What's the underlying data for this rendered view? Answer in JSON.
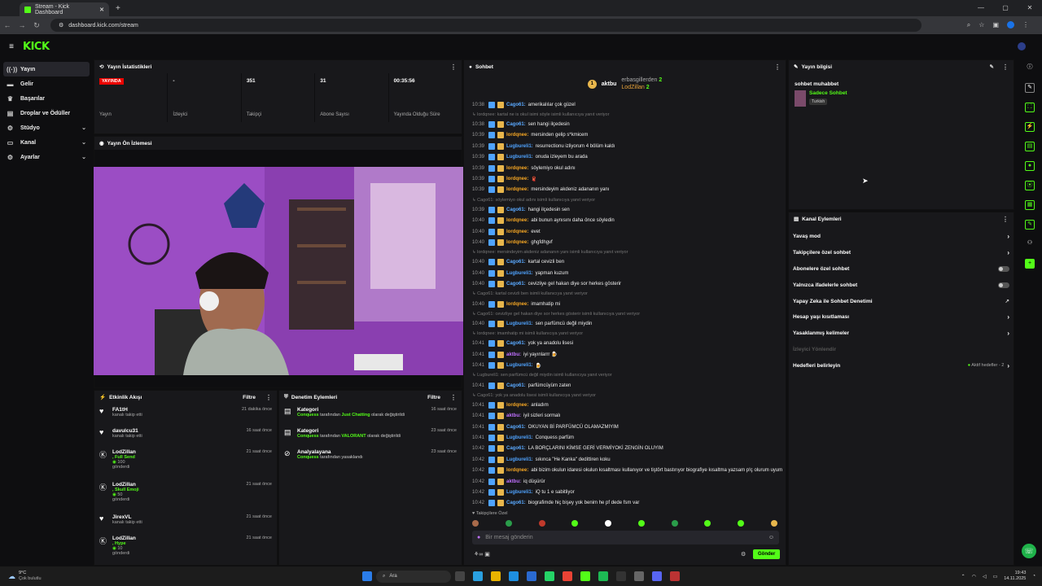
{
  "browser": {
    "tab_title": "Stream - Kick Dashboard",
    "url": "dashboard.kick.com/stream"
  },
  "brand": {
    "logo": "KICK",
    "accent": "#53fc18"
  },
  "sidebar": {
    "items": [
      {
        "label": "Yayın",
        "icon": "broadcast-icon",
        "active": true,
        "chevron": false
      },
      {
        "label": "Gelir",
        "icon": "money-icon",
        "active": false,
        "chevron": false
      },
      {
        "label": "Başarılar",
        "icon": "trophy-icon",
        "active": false,
        "chevron": false
      },
      {
        "label": "Droplar ve Ödüller",
        "icon": "gift-icon",
        "active": false,
        "chevron": false
      },
      {
        "label": "Stüdyo",
        "icon": "studio-icon",
        "active": false,
        "chevron": true
      },
      {
        "label": "Kanal",
        "icon": "channel-icon",
        "active": false,
        "chevron": true
      },
      {
        "label": "Ayarlar",
        "icon": "gear-icon",
        "active": false,
        "chevron": true
      }
    ]
  },
  "stats_panel": {
    "title": "Yayın İstatistikleri",
    "stats": [
      {
        "value": "YAYINDA",
        "label": "Yayın"
      },
      {
        "value": "-",
        "label": "İzleyici"
      },
      {
        "value": "351",
        "label": "Takipçi"
      },
      {
        "value": "31",
        "label": "Abone Sayısı"
      },
      {
        "value": "00:35:56",
        "label": "Yayında Olduğu Süre"
      }
    ]
  },
  "preview_panel": {
    "title": "Yayın Ön İzlemesi"
  },
  "activity_panel": {
    "title": "Etkinlik Akışı",
    "filter": "Filtre",
    "items": [
      {
        "icon": "heart-icon",
        "name": "FA1tH",
        "sub": "kanalı takip etti",
        "extra": "",
        "amount": "",
        "time": "21 dakika önce"
      },
      {
        "icon": "heart-icon",
        "name": "davulcu31",
        "sub": "kanalı takip etti",
        "extra": "",
        "amount": "",
        "time": "16 saat önce"
      },
      {
        "icon": "kick-icon",
        "name": "LodZillan",
        "sub": "gönderdi",
        "extra": ", Full Send",
        "amount": "100",
        "time": "21 saat önce"
      },
      {
        "icon": "kick-icon",
        "name": "LodZillan",
        "sub": "gönderdi",
        "extra": ", Skull Emoji",
        "amount": "50",
        "time": "21 saat önce"
      },
      {
        "icon": "heart-icon",
        "name": "JirexVL",
        "sub": "kanalı takip etti",
        "extra": "",
        "amount": "",
        "time": "21 saat önce"
      },
      {
        "icon": "kick-icon",
        "name": "LodZillan",
        "sub": "gönderdi",
        "extra": ", Hype",
        "amount": "10",
        "time": "21 saat önce"
      }
    ]
  },
  "moderation_panel": {
    "title": "Denetim Eylemleri",
    "filter": "Filtre",
    "items": [
      {
        "icon": "category-icon",
        "name": "Kategori",
        "who": "Conquess",
        "mid": " tarafından ",
        "target": "Just Chatting",
        "end": " olarak değiştirildi",
        "time": "16 saat önce"
      },
      {
        "icon": "category-icon",
        "name": "Kategori",
        "who": "Conquess",
        "mid": " tarafından ",
        "target": "VALORANT",
        "end": " olarak değiştirildi",
        "time": "23 saat önce"
      },
      {
        "icon": "ban-icon",
        "name": "Analyalayana",
        "who": "Conquess",
        "mid": " tarafından yasaklandı",
        "target": "",
        "end": "",
        "time": "23 saat önce"
      }
    ]
  },
  "chat_panel": {
    "title": "Sohbet",
    "leaderboard": [
      {
        "name": "aktbu",
        "count": "",
        "color": "#e8b64c"
      },
      {
        "name": "erbasgillerden",
        "count": "2",
        "color": "#aaaaaa"
      },
      {
        "name": "LodZillan",
        "count": "2",
        "color": "#e8a33a"
      }
    ],
    "lines": [
      {
        "type": "msg",
        "ts": "10:38",
        "user": "Cago61:",
        "ucolor": "#5aa9ff",
        "text": " amerikalılar çok güzel"
      },
      {
        "type": "reply",
        "text": "lordqnee: kartal ne is okul isimi söyle isimli kullanıcıya yanıt veriyor"
      },
      {
        "type": "msg",
        "ts": "10:38",
        "user": "Cago61:",
        "ucolor": "#5aa9ff",
        "text": " sen hangi ilçedesin"
      },
      {
        "type": "msg",
        "ts": "10:39",
        "user": "lordqnee:",
        "ucolor": "#f5a623",
        "text": " mersinden gelip s*kmicem"
      },
      {
        "type": "msg",
        "ts": "10:39",
        "user": "Lugbureli1:",
        "ucolor": "#4fa3ff",
        "text": " resurrectionu izliyorum 4 bölüm kaldı"
      },
      {
        "type": "msg",
        "ts": "10:39",
        "user": "Lugbureli1:",
        "ucolor": "#4fa3ff",
        "text": " onuda izleyem bu arada"
      },
      {
        "type": "msg",
        "ts": "10:39",
        "user": "lordqnee:",
        "ucolor": "#f5a623",
        "text": " söylemiyo okul adını"
      },
      {
        "type": "msg",
        "ts": "10:39",
        "user": "lordqnee:",
        "ucolor": "#f5a623",
        "text": " 🧣"
      },
      {
        "type": "msg",
        "ts": "10:39",
        "user": "lordqnee:",
        "ucolor": "#f5a623",
        "text": " mersindeyim akdeniz adananın yanı"
      },
      {
        "type": "reply",
        "text": "Cago61: söylemiyo okul adını isimli kullanıcıya yanıt veriyor"
      },
      {
        "type": "msg",
        "ts": "10:39",
        "user": "Cago61:",
        "ucolor": "#5aa9ff",
        "text": " hangi ilçedesin sen"
      },
      {
        "type": "msg",
        "ts": "10:40",
        "user": "lordqnee:",
        "ucolor": "#f5a623",
        "text": " abi bunun aynısını daha önce söyledin"
      },
      {
        "type": "msg",
        "ts": "10:40",
        "user": "lordqnee:",
        "ucolor": "#f5a623",
        "text": " evet"
      },
      {
        "type": "msg",
        "ts": "10:40",
        "user": "lordqnee:",
        "ucolor": "#f5a623",
        "text": " ghgfdhgvf"
      },
      {
        "type": "reply",
        "text": "lordqnee: mersindeyim akdeniz adananın yanı isimli kullanıcıya yanıt veriyor"
      },
      {
        "type": "msg",
        "ts": "10:40",
        "user": "Cago61:",
        "ucolor": "#5aa9ff",
        "text": " kartal cevizli ben"
      },
      {
        "type": "msg",
        "ts": "10:40",
        "user": "Lugbureli1:",
        "ucolor": "#4fa3ff",
        "text": " yapman kuzum"
      },
      {
        "type": "msg",
        "ts": "10:40",
        "user": "Cago61:",
        "ucolor": "#5aa9ff",
        "text": " cevizliye gel hakan diye sor herkes gösterir"
      },
      {
        "type": "reply",
        "text": "Cago61: kartal cevizli ben isimli kullanıcıya yanıt veriyor"
      },
      {
        "type": "msg",
        "ts": "10:40",
        "user": "lordqnee:",
        "ucolor": "#f5a623",
        "text": " imamhatip mi"
      },
      {
        "type": "reply",
        "text": "Cago61: cevizliye gel hakan diye sor herkes gösterir isimli kullanıcıya yanıt veriyor"
      },
      {
        "type": "msg",
        "ts": "10:40",
        "user": "Lugbureli1:",
        "ucolor": "#4fa3ff",
        "text": " sen parfümcü değil miydin"
      },
      {
        "type": "reply",
        "text": "lordqnee: imamhatip mi isimli kullanıcıya yanıt veriyor"
      },
      {
        "type": "msg",
        "ts": "10:41",
        "user": "Cago61:",
        "ucolor": "#5aa9ff",
        "text": " yok ya anadolu lisesi"
      },
      {
        "type": "msg",
        "ts": "10:41",
        "user": "aktbu:",
        "ucolor": "#c070ff",
        "text": " iyi yayınlarrr 🍺"
      },
      {
        "type": "msg",
        "ts": "10:41",
        "user": "Lugbureli1:",
        "ucolor": "#4fa3ff",
        "text": " 🍺"
      },
      {
        "type": "reply",
        "text": "Lugbureli1: sen parfümcü değil miydin isimli kullanıcıya yanıt veriyor"
      },
      {
        "type": "msg",
        "ts": "10:41",
        "user": "Cago61:",
        "ucolor": "#5aa9ff",
        "text": " parfümcüyüm zaten"
      },
      {
        "type": "reply",
        "text": "Cago61: yok ya anadolu lisesi isimli kullanıcıya yanıt veriyor"
      },
      {
        "type": "msg",
        "ts": "10:41",
        "user": "lordqnee:",
        "ucolor": "#f5a623",
        "text": " anladım"
      },
      {
        "type": "msg",
        "ts": "10:41",
        "user": "aktbu:",
        "ucolor": "#c070ff",
        "text": " iyil sizleri sormalı"
      },
      {
        "type": "msg",
        "ts": "10:41",
        "user": "Cago61:",
        "ucolor": "#5aa9ff",
        "text": " OKUYAN Bİ PARFÜMCÜ OLAMAZMIYIM"
      },
      {
        "type": "msg",
        "ts": "10:41",
        "user": "Lugbureli1:",
        "ucolor": "#4fa3ff",
        "text": " Conquess parfüm"
      },
      {
        "type": "msg",
        "ts": "10:42",
        "user": "Cago61:",
        "ucolor": "#5aa9ff",
        "text": " LA BORÇLARINI KİMSE GERİ VERMİYOKİ ZENGİN OLUYIM"
      },
      {
        "type": "msg",
        "ts": "10:42",
        "user": "Lugbureli1:",
        "ucolor": "#4fa3ff",
        "text": " sıkınca \"He Kanka\" dedittiren koku"
      },
      {
        "type": "msg",
        "ts": "10:42",
        "user": "lordqnee:",
        "ucolor": "#f5a623",
        "text": " abi bizim okulun idaresi okulun kısaltması kullanıyor ve tiştört bastırıyor biografiye kısaltma yazsam p!ç olurum uyum"
      },
      {
        "type": "msg",
        "ts": "10:42",
        "user": "aktbu:",
        "ucolor": "#c070ff",
        "text": " iq düşürür"
      },
      {
        "type": "msg",
        "ts": "10:42",
        "user": "Lugbureli1:",
        "ucolor": "#4fa3ff",
        "text": " iQ tu 1 e sabitliyor"
      },
      {
        "type": "msg",
        "ts": "10:42",
        "user": "Cago61:",
        "ucolor": "#5aa9ff",
        "text": " biografimde hiç bişey yok benim he pf dede fsm var"
      },
      {
        "type": "msg",
        "ts": "10:42",
        "user": "Lugbureli1:",
        "ucolor": "#4fa3ff",
        "text": " böylelikle oto bir şekilde VIP rozeti akyorsun chatte"
      }
    ],
    "followers_only": "Takipçilere Özel",
    "input_placeholder": "Bir mesaj gönderin",
    "send_label": "Gönder"
  },
  "stream_info": {
    "title": "Yayın bilgisi",
    "stream_title": "sohbet muhabbet",
    "category": "Sadece Sohbet",
    "language": "Turkish"
  },
  "channel_actions": {
    "title": "Kanal Eylemleri",
    "items": [
      {
        "label": "Yavaş mod",
        "control": "chevron",
        "disabled": false
      },
      {
        "label": "Takipçilere özel sohbet",
        "control": "chevron",
        "disabled": false
      },
      {
        "label": "Abonelere özel sohbet",
        "control": "toggle",
        "disabled": false
      },
      {
        "label": "Yalnızca ifadelerle sohbet",
        "control": "toggle",
        "disabled": false
      },
      {
        "label": "Yapay Zeka ile Sohbet Denetimi",
        "control": "external",
        "disabled": false
      },
      {
        "label": "Hesap yaşı kısıtlaması",
        "control": "chevron",
        "disabled": false
      },
      {
        "label": "Yasaklanmış kelimeler",
        "control": "chevron",
        "disabled": false
      },
      {
        "label": "İzleyici Yönlendir",
        "control": "none",
        "disabled": true
      },
      {
        "label": "Hedefleri belirleyin",
        "control": "chevron",
        "disabled": false
      }
    ],
    "goals_status": "Aktif hedefler - 2"
  },
  "taskbar": {
    "weather_temp": "9°C",
    "weather_text": "Çok bulutlu",
    "search": "Ara",
    "time": "19:43",
    "date": "14.11.2025"
  }
}
